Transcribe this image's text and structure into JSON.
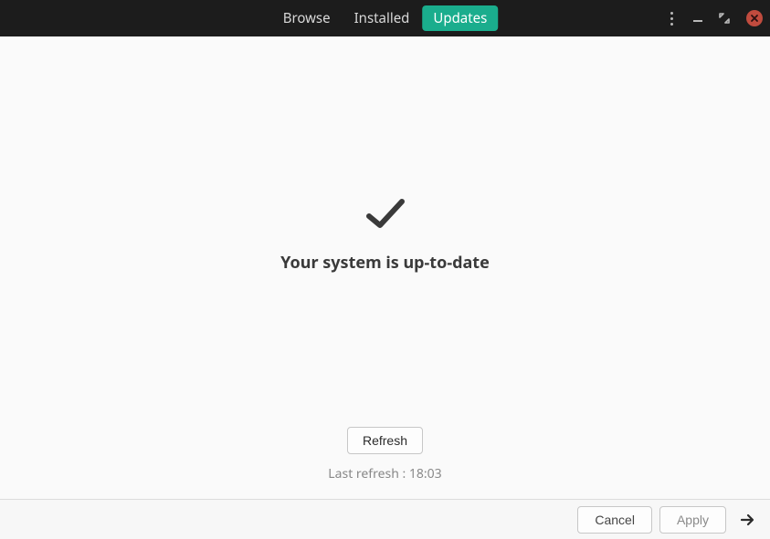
{
  "header": {
    "tabs": {
      "browse": "Browse",
      "installed": "Installed",
      "updates": "Updates"
    }
  },
  "main": {
    "status_heading": "Your system is up-to-date",
    "refresh_label": "Refresh",
    "last_refresh": "Last refresh : 18:03"
  },
  "footer": {
    "cancel": "Cancel",
    "apply": "Apply"
  },
  "colors": {
    "accent": "#1aad8d",
    "header_bg": "#1c1c1c",
    "close": "#c04b3e"
  }
}
